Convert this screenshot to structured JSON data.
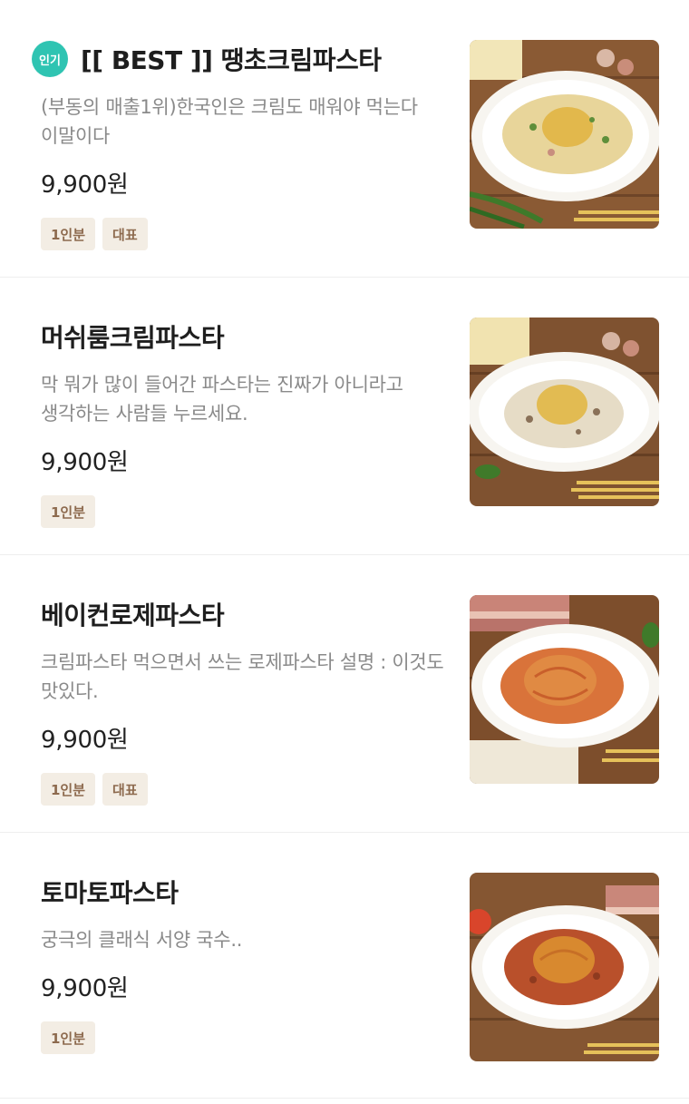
{
  "menu": {
    "popular_badge": "인기",
    "items": [
      {
        "name": "[[ BEST ]] 땡초크림파스타",
        "description": "(부동의 매출1위)한국인은 크림도 매워야 먹는다 이말이다",
        "price": "9,900원",
        "tags": [
          "1인분",
          "대표"
        ],
        "popular": true,
        "sauce": "cream-pepper"
      },
      {
        "name": "머쉬룸크림파스타",
        "description": "막 뭐가 많이 들어간 파스타는 진짜가 아니라고 생각하는 사람들 누르세요.",
        "price": "9,900원",
        "tags": [
          "1인분"
        ],
        "popular": false,
        "sauce": "mushroom-cream"
      },
      {
        "name": "베이컨로제파스타",
        "description": "크림파스타 먹으면서 쓰는 로제파스타 설명 : 이것도 맛있다.",
        "price": "9,900원",
        "tags": [
          "1인분",
          "대표"
        ],
        "popular": false,
        "sauce": "rose"
      },
      {
        "name": "토마토파스타",
        "description": "궁극의 클래식 서양 국수..",
        "price": "9,900원",
        "tags": [
          "1인분"
        ],
        "popular": false,
        "sauce": "tomato"
      }
    ]
  },
  "colors": {
    "badge_teal": "#2fc4b2",
    "tag_bg": "#f3ede4",
    "tag_text": "#8d6a4e",
    "desc_gray": "#8a8a8a",
    "divider": "#eeeeee"
  }
}
